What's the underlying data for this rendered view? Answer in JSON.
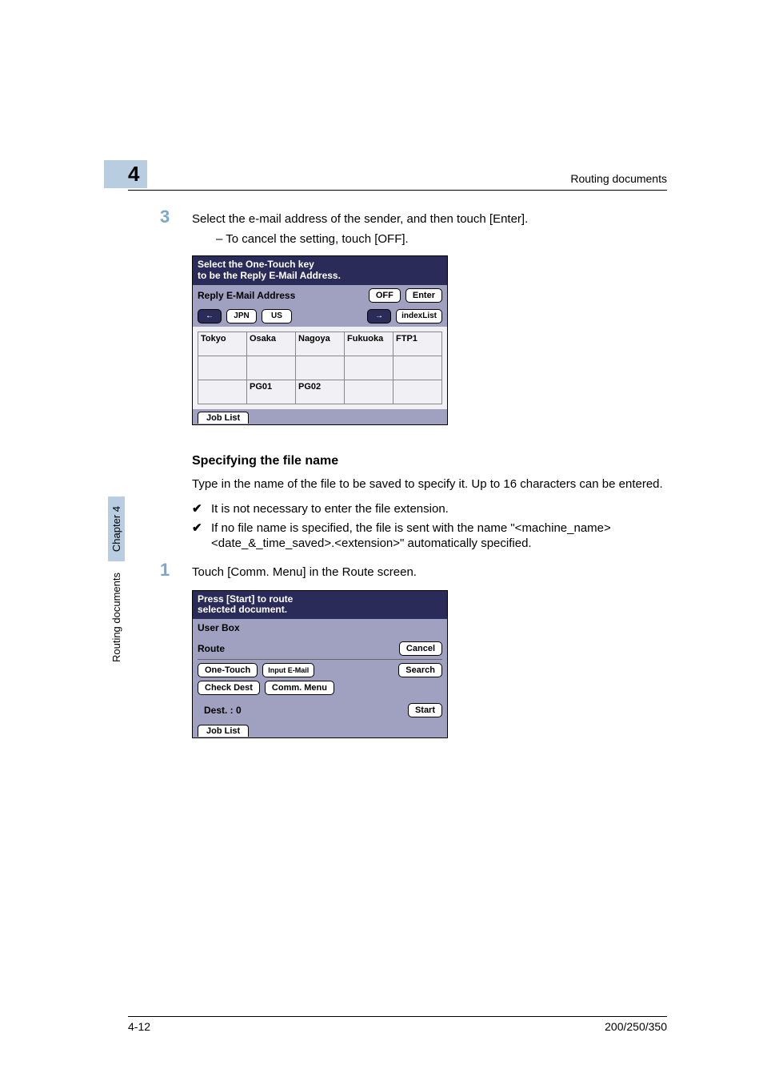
{
  "header": {
    "chapter_number": "4",
    "section_title": "Routing documents"
  },
  "side_tab": {
    "chapter_label": "Chapter 4",
    "doc_label": "Routing documents"
  },
  "step3": {
    "number": "3",
    "text": "Select the e-mail address of the sender, and then touch [Enter].",
    "sub": "To cancel the setting, touch [OFF]."
  },
  "screen1": {
    "title_line1": "Select the One-Touch key",
    "title_line2": "to be the Reply E-Mail Address.",
    "reply_label": "Reply E-Mail Address",
    "off_btn": "OFF",
    "enter_btn": "Enter",
    "left_arrow": "←",
    "jpn": "JPN",
    "us": "US",
    "right_arrow": "→",
    "indexlist": "indexList",
    "cells": [
      [
        "Tokyo",
        "Osaka",
        "Nagoya",
        "Fukuoka",
        "FTP1"
      ],
      [
        "",
        "",
        "",
        "",
        ""
      ],
      [
        "",
        "PG01",
        "PG02",
        "",
        ""
      ]
    ],
    "joblist": "Job List"
  },
  "spec_heading": "Specifying the file name",
  "spec_para": "Type in the name of the file to be saved to specify it. Up to 16 characters can be entered.",
  "checks": {
    "a": "It is not necessary to enter the file extension.",
    "b": "If no file name is specified, the file is sent with the name \"<machine_name><date_&_time_saved>.<extension>\" automatically specified."
  },
  "step1": {
    "number": "1",
    "text": "Touch [Comm. Menu] in the Route screen."
  },
  "screen2": {
    "title_line1": "Press [Start] to route",
    "title_line2": "selected document.",
    "userbox": "User Box",
    "route": "Route",
    "cancel": "Cancel",
    "one_touch": "One-Touch",
    "input_email": "Input E-Mail",
    "search": "Search",
    "check_dest": "Check Dest",
    "comm_menu": "Comm. Menu",
    "dest_label": "Dest.  :   0",
    "start": "Start",
    "joblist": "Job List"
  },
  "footer": {
    "left": "4-12",
    "right": "200/250/350"
  }
}
